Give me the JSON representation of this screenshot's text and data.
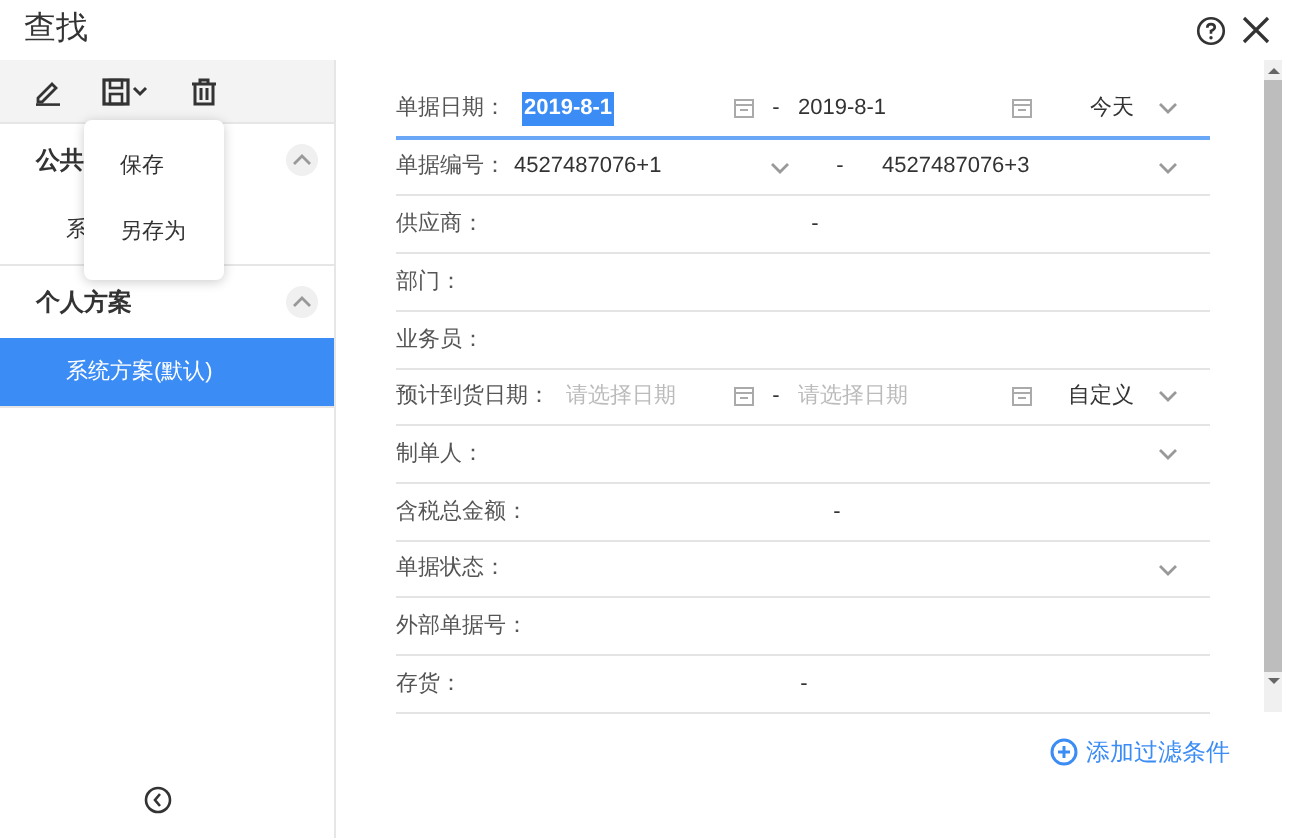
{
  "window": {
    "title": "查找"
  },
  "save_menu": {
    "items": [
      "保存",
      "另存为"
    ]
  },
  "sidebar": {
    "groups": [
      {
        "title": "公共",
        "expanded": true,
        "items": [
          {
            "label": "系",
            "selected": false
          }
        ]
      },
      {
        "title": "个人方案",
        "expanded": true,
        "items": [
          {
            "label": "系统方案(默认)",
            "selected": true
          }
        ]
      }
    ]
  },
  "filters": [
    {
      "kind": "date-range",
      "label": "单据日期：",
      "from": {
        "value": "2019-8-1",
        "selected": true
      },
      "separator": "-",
      "to": {
        "value": "2019-8-1"
      },
      "preset": "今天",
      "active": true
    },
    {
      "kind": "select-range",
      "label": "单据编号：",
      "from": {
        "value": "4527487076+1"
      },
      "separator": "-",
      "to": {
        "value": "4527487076+3"
      },
      "active": false
    },
    {
      "kind": "range",
      "label": "供应商：",
      "separator": "-",
      "active": false
    },
    {
      "kind": "text",
      "label": "部门：",
      "active": false
    },
    {
      "kind": "text",
      "label": "业务员：",
      "active": false
    },
    {
      "kind": "date-range",
      "label": "预计到货日期：",
      "from": {
        "placeholder": "请选择日期",
        "selected": false
      },
      "separator": "-",
      "to": {
        "placeholder": "请选择日期"
      },
      "preset": "自定义",
      "active": false
    },
    {
      "kind": "select",
      "label": "制单人：",
      "active": false
    },
    {
      "kind": "range",
      "label": "含税总金额：",
      "separator": "-",
      "active": false
    },
    {
      "kind": "select",
      "label": "单据状态：",
      "active": false
    },
    {
      "kind": "text",
      "label": "外部单据号：",
      "active": false
    },
    {
      "kind": "range",
      "label": "存货：",
      "separator": "-",
      "active": false
    }
  ],
  "add_filter": "添加过滤条件"
}
